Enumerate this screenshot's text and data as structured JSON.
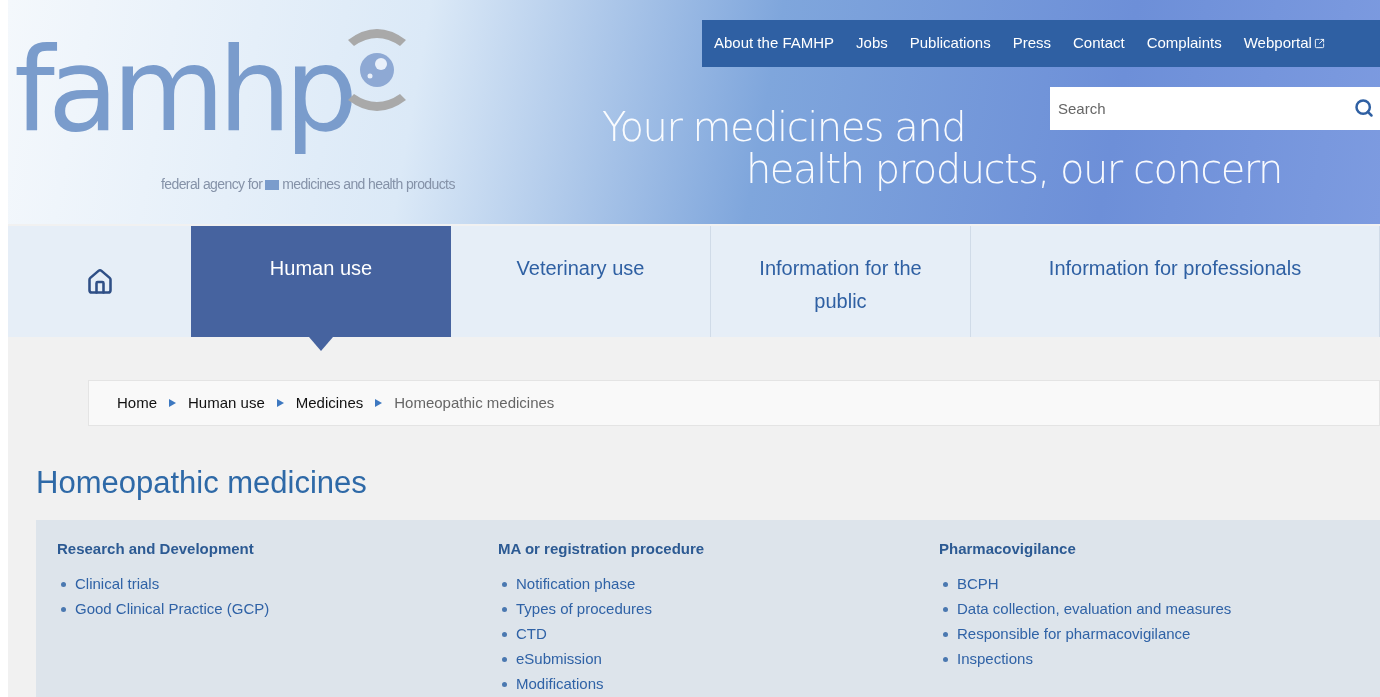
{
  "logo": {
    "name": "famhp",
    "subtitle_left": "federal agency for",
    "subtitle_right": "medicines and health products"
  },
  "top_links": [
    {
      "label": "About the FAMHP",
      "external": false
    },
    {
      "label": "Jobs",
      "external": false
    },
    {
      "label": "Publications",
      "external": false
    },
    {
      "label": "Press",
      "external": false
    },
    {
      "label": "Contact",
      "external": false
    },
    {
      "label": "Complaints",
      "external": false
    },
    {
      "label": "Webportal",
      "external": true
    }
  ],
  "search": {
    "placeholder": "Search"
  },
  "tagline": [
    "Your medicines and",
    "health products, our concern"
  ],
  "main_nav": [
    {
      "label": "Human use",
      "selected": true
    },
    {
      "label": "Veterinary use",
      "selected": false
    },
    {
      "label": "Information for the public",
      "selected": false
    },
    {
      "label": "Information for professionals",
      "selected": false
    }
  ],
  "breadcrumb": [
    {
      "label": "Home",
      "current": false
    },
    {
      "label": "Human use",
      "current": false
    },
    {
      "label": "Medicines",
      "current": false
    },
    {
      "label": "Homeopathic medicines",
      "current": true
    }
  ],
  "page_title": "Homeopathic medicines",
  "sections": [
    {
      "title": "Research and Development",
      "items": [
        "Clinical trials",
        "Good Clinical Practice (GCP)"
      ]
    },
    {
      "title": "MA or registration procedure",
      "items": [
        "Notification phase",
        "Types of procedures",
        "CTD",
        "eSubmission",
        "Modifications"
      ]
    },
    {
      "title": "Pharmacovigilance",
      "items": [
        "BCPH",
        "Data collection, evaluation and measures",
        "Responsible for pharmacovigilance",
        "Inspections"
      ]
    }
  ]
}
